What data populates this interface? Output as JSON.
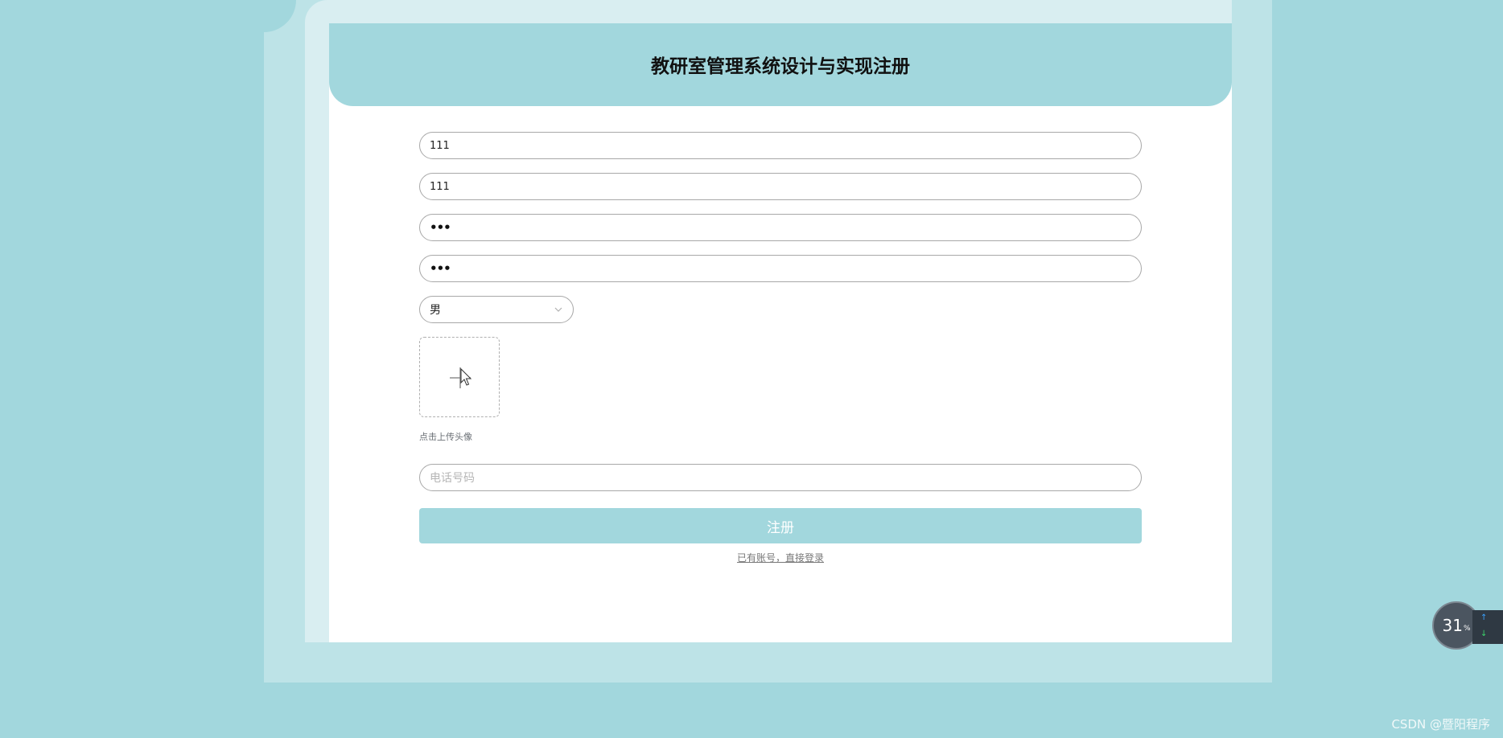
{
  "header": {
    "title": "教研室管理系统设计与实现注册"
  },
  "form": {
    "account_value": "111",
    "name_value": "111",
    "password_value": "•••",
    "confirm_password_value": "•••",
    "gender_selected": "男",
    "upload_hint": "点击上传头像",
    "phone_placeholder": "电话号码",
    "register_label": "注册",
    "login_link": "已有账号，直接登录"
  },
  "widget": {
    "speed_value": "31",
    "speed_unit": "%"
  },
  "watermark": "CSDN @暨阳程序",
  "colors": {
    "background": "#a2d7dd",
    "outer_frame": "#bde3e7",
    "inner_frame": "#d9eef1",
    "accent": "#a2d7dd"
  },
  "icons": {
    "upload": "plus-icon",
    "cursor": "cursor-icon",
    "select": "chevron-down-icon"
  }
}
